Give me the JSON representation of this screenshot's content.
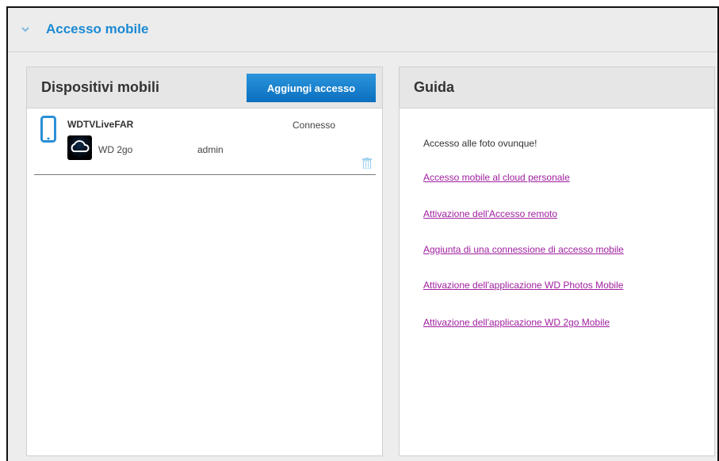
{
  "section": {
    "title": "Accesso mobile"
  },
  "devices_panel": {
    "title": "Dispositivi mobili",
    "add_button": "Aggiungi accesso",
    "devices": [
      {
        "name": "WDTVLiveFAR",
        "status": "Connesso",
        "app": "WD 2go",
        "user": "admin"
      }
    ]
  },
  "guide_panel": {
    "title": "Guida",
    "intro": "Accesso alle foto ovunque!",
    "links": [
      "Accesso mobile al cloud personale",
      "Attivazione dell'Accesso remoto",
      "Aggiunta di una connessione di accesso mobile",
      "Attivazione dell'applicazione WD Photos Mobile",
      "Attivazione dell'applicazione WD 2go Mobile"
    ]
  },
  "colors": {
    "accent": "#1c8ad3",
    "button": "#0a6fbf",
    "link": "#a020a0"
  },
  "icons": [
    "chevron-down-icon",
    "phone-icon",
    "cloud-app-icon",
    "trash-icon"
  ]
}
